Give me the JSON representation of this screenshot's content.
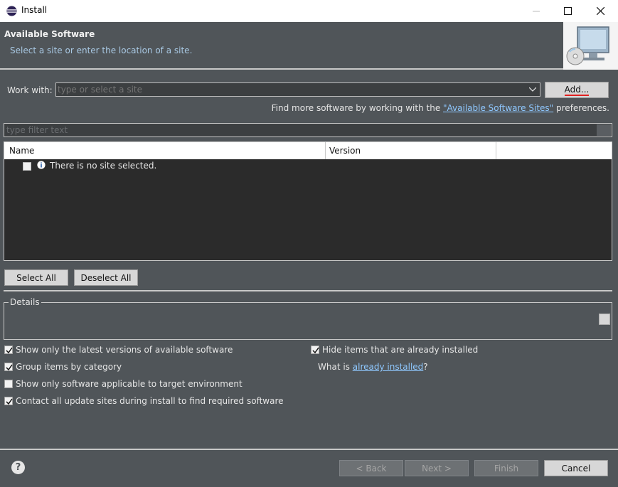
{
  "window": {
    "title": "Install"
  },
  "banner": {
    "heading": "Available Software",
    "subtitle": "Select a site or enter the location of a site."
  },
  "work_with": {
    "label": "Work with:",
    "value": "",
    "placeholder": "type or select a site",
    "add_button": "Add..."
  },
  "find_more": {
    "prefix": "Find more software by working with the ",
    "link": "\"Available Software Sites\"",
    "suffix": " preferences."
  },
  "filter": {
    "placeholder": "type filter text"
  },
  "table": {
    "columns": [
      "Name",
      "Version"
    ],
    "rows": [
      {
        "text": "There is no site selected.",
        "checked": false
      }
    ]
  },
  "buttons": {
    "select_all": "Select All",
    "deselect_all": "Deselect All"
  },
  "details": {
    "legend": "Details"
  },
  "options": {
    "latest_versions": {
      "label": "Show only the latest versions of available software",
      "checked": true
    },
    "group_by_category": {
      "label": "Group items by category",
      "checked": true
    },
    "target_env": {
      "label": "Show only software applicable to target environment",
      "checked": false
    },
    "contact_sites": {
      "label": "Contact all update sites during install to find required software",
      "checked": true
    },
    "hide_installed": {
      "label": "Hide items that are already installed",
      "checked": true
    }
  },
  "what_is": {
    "prefix": "What is ",
    "link": "already installed",
    "suffix": "?"
  },
  "footer": {
    "help": "?",
    "back": "< Back",
    "next": "Next >",
    "finish": "Finish",
    "cancel": "Cancel"
  },
  "colors": {
    "background": "#505559",
    "link": "#8fc8ff",
    "table_bg": "#2b2b2b"
  }
}
